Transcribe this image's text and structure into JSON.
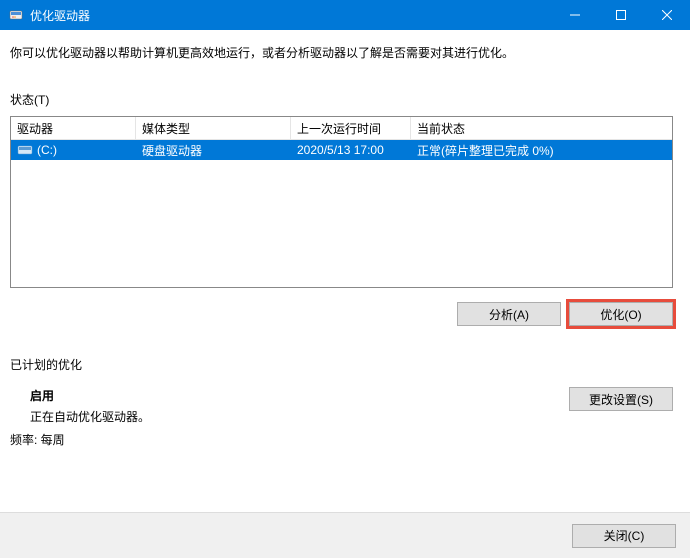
{
  "window": {
    "title": "优化驱动器"
  },
  "description": "你可以优化驱动器以帮助计算机更高效地运行，或者分析驱动器以了解是否需要对其进行优化。",
  "status_label": "状态(T)",
  "columns": {
    "drive": "驱动器",
    "media": "媒体类型",
    "lastrun": "上一次运行时间",
    "status": "当前状态"
  },
  "drives": [
    {
      "name": "(C:)",
      "media": "硬盘驱动器",
      "lastrun": "2020/5/13 17:00",
      "status": "正常(碎片整理已完成 0%)"
    }
  ],
  "buttons": {
    "analyze": "分析(A)",
    "optimize": "优化(O)",
    "change_settings": "更改设置(S)",
    "close": "关闭(C)"
  },
  "schedule": {
    "label": "已计划的优化",
    "on": "启用",
    "description": "正在自动优化驱动器。",
    "frequency": "频率: 每周"
  }
}
